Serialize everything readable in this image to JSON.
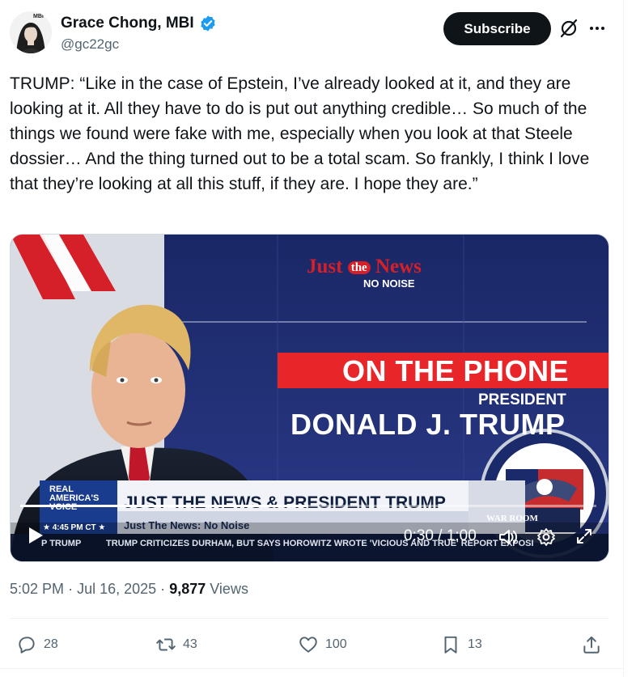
{
  "author": {
    "name": "Grace Chong, MBI",
    "handle": "@gc22gc",
    "avatar_badge": "MBI"
  },
  "header": {
    "subscribe_label": "Subscribe",
    "grok_icon": "grok-icon",
    "more_icon": "more-icon"
  },
  "tweet": {
    "text": "TRUMP: “Like in the case of Epstein, I’ve already looked at it, and they are looking at it. All they have to do is put out anything credible… So much of the things we found were fake with me, especially when you look at that Steele dossier… And the thing turned out to be a total scam. So frankly, I think I love that they’re looking at all this stuff, if they are. I hope they are.”"
  },
  "video": {
    "logo_just": "Just",
    "logo_the": "the",
    "logo_news": "News",
    "logo_tagline": "NO NOISE",
    "headline": "ON THE PHONE",
    "subtitle": "PRESIDENT",
    "name": "DONALD J. TRUMP",
    "network_line1": "REAL",
    "network_line2": "AMERICA'S",
    "network_line3": "VOICE",
    "clock": "★ 4:45 PM CT ★",
    "ticker": "JUST THE NEWS & PRESIDENT TRUMP",
    "ticker_sub": "Just The News: No Noise",
    "crawl_left": "P TRUMP",
    "crawl": "TRUMP CRITICIZES DURHAM, BUT SAYS HOROWITZ WROTE 'VICIOUS AND TRUE' REPORT EXPOSI",
    "war_room": "WAR ROOM",
    "time_display": "0:30 / 1:00",
    "progress_fraction": 0.5
  },
  "meta": {
    "time": "5:02 PM",
    "separator": "·",
    "date": "Jul 16, 2025",
    "views_count": "9,877",
    "views_label": "Views"
  },
  "actions": {
    "reply_count": "28",
    "retweet_count": "43",
    "like_count": "100",
    "bookmark_count": "13"
  },
  "colors": {
    "text_primary": "#0f1419",
    "text_secondary": "#536471",
    "verified_blue": "#1d9bf0",
    "broadcast_red": "#e8262a",
    "broadcast_navy": "#1c2a6b"
  }
}
